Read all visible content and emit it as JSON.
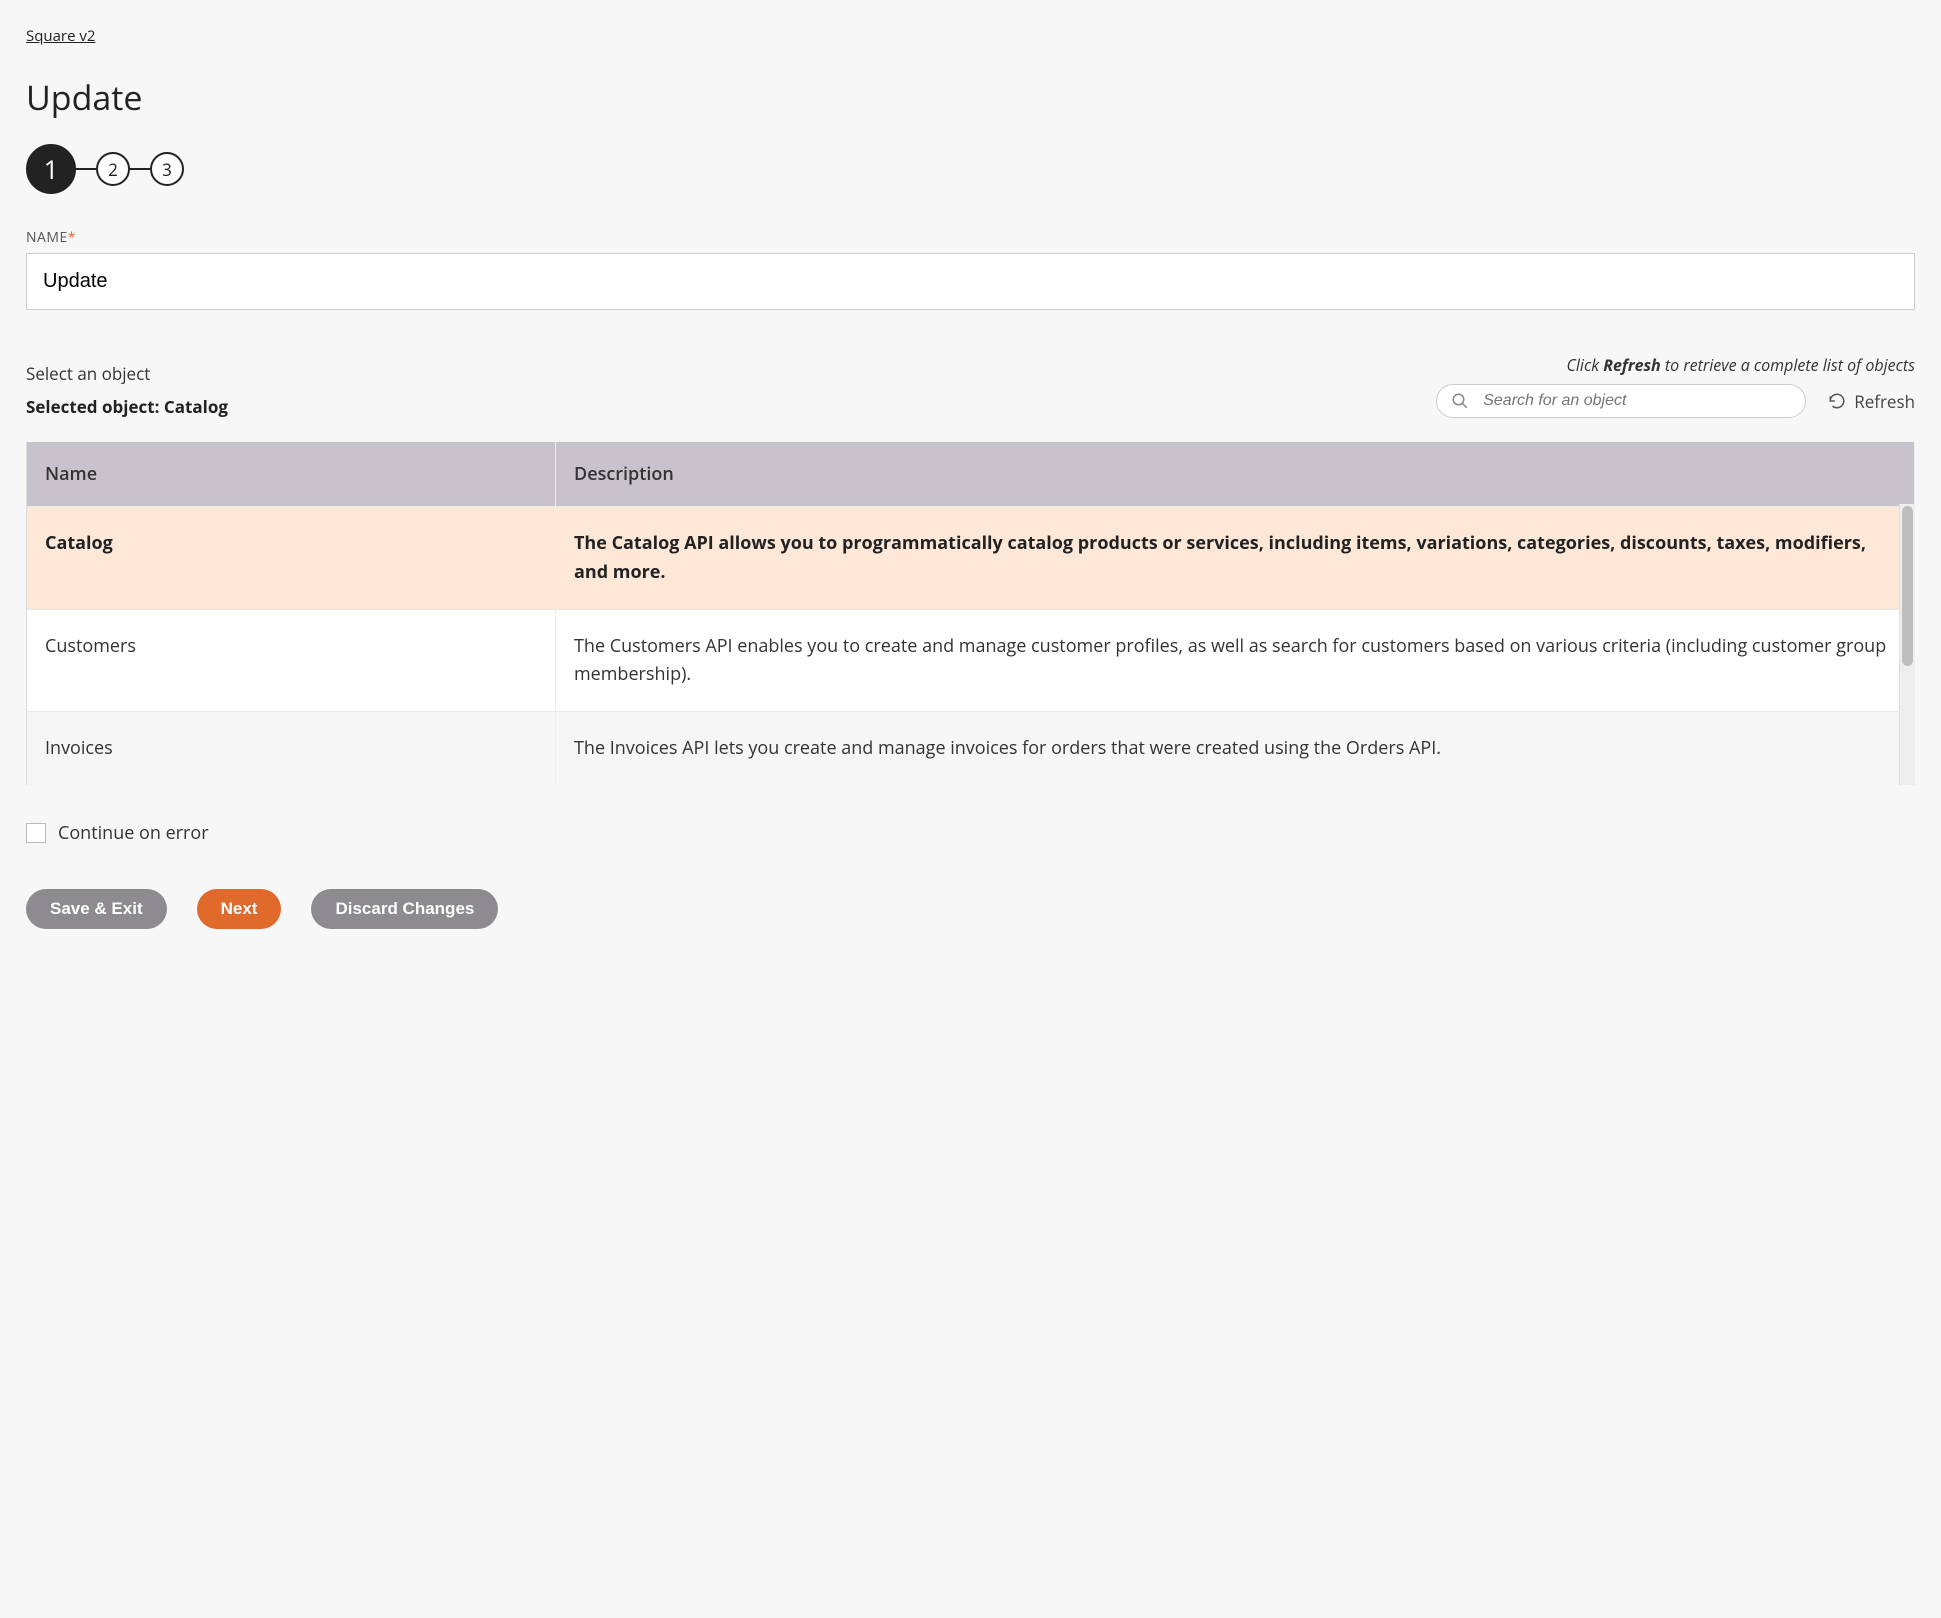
{
  "breadcrumb": "Square v2",
  "page_title": "Update",
  "stepper": {
    "steps": [
      "1",
      "2",
      "3"
    ],
    "active_index": 0
  },
  "name_field": {
    "label": "NAME",
    "required_marker": "*",
    "value": "Update"
  },
  "select": {
    "title": "Select an object",
    "selected_prefix": "Selected object: ",
    "selected_value": "Catalog",
    "hint_pre": "Click ",
    "hint_bold": "Refresh",
    "hint_post": " to retrieve a complete list of objects"
  },
  "search": {
    "placeholder": "Search for an object"
  },
  "refresh": {
    "label": "Refresh"
  },
  "table": {
    "headers": {
      "name": "Name",
      "description": "Description"
    },
    "rows": [
      {
        "name": "Catalog",
        "description": "The Catalog API allows you to programmatically catalog products or services, including items, variations, categories, discounts, taxes, modifiers, and more.",
        "selected": true
      },
      {
        "name": "Customers",
        "description": "The Customers API enables you to create and manage customer profiles, as well as search for customers based on various criteria (including customer group membership)."
      },
      {
        "name": "Invoices",
        "description": "The Invoices API lets you create and manage invoices for orders that were created using the Orders API."
      }
    ]
  },
  "continue_on_error": {
    "label": "Continue on error",
    "checked": false
  },
  "buttons": {
    "save_exit": "Save & Exit",
    "next": "Next",
    "discard": "Discard Changes"
  }
}
